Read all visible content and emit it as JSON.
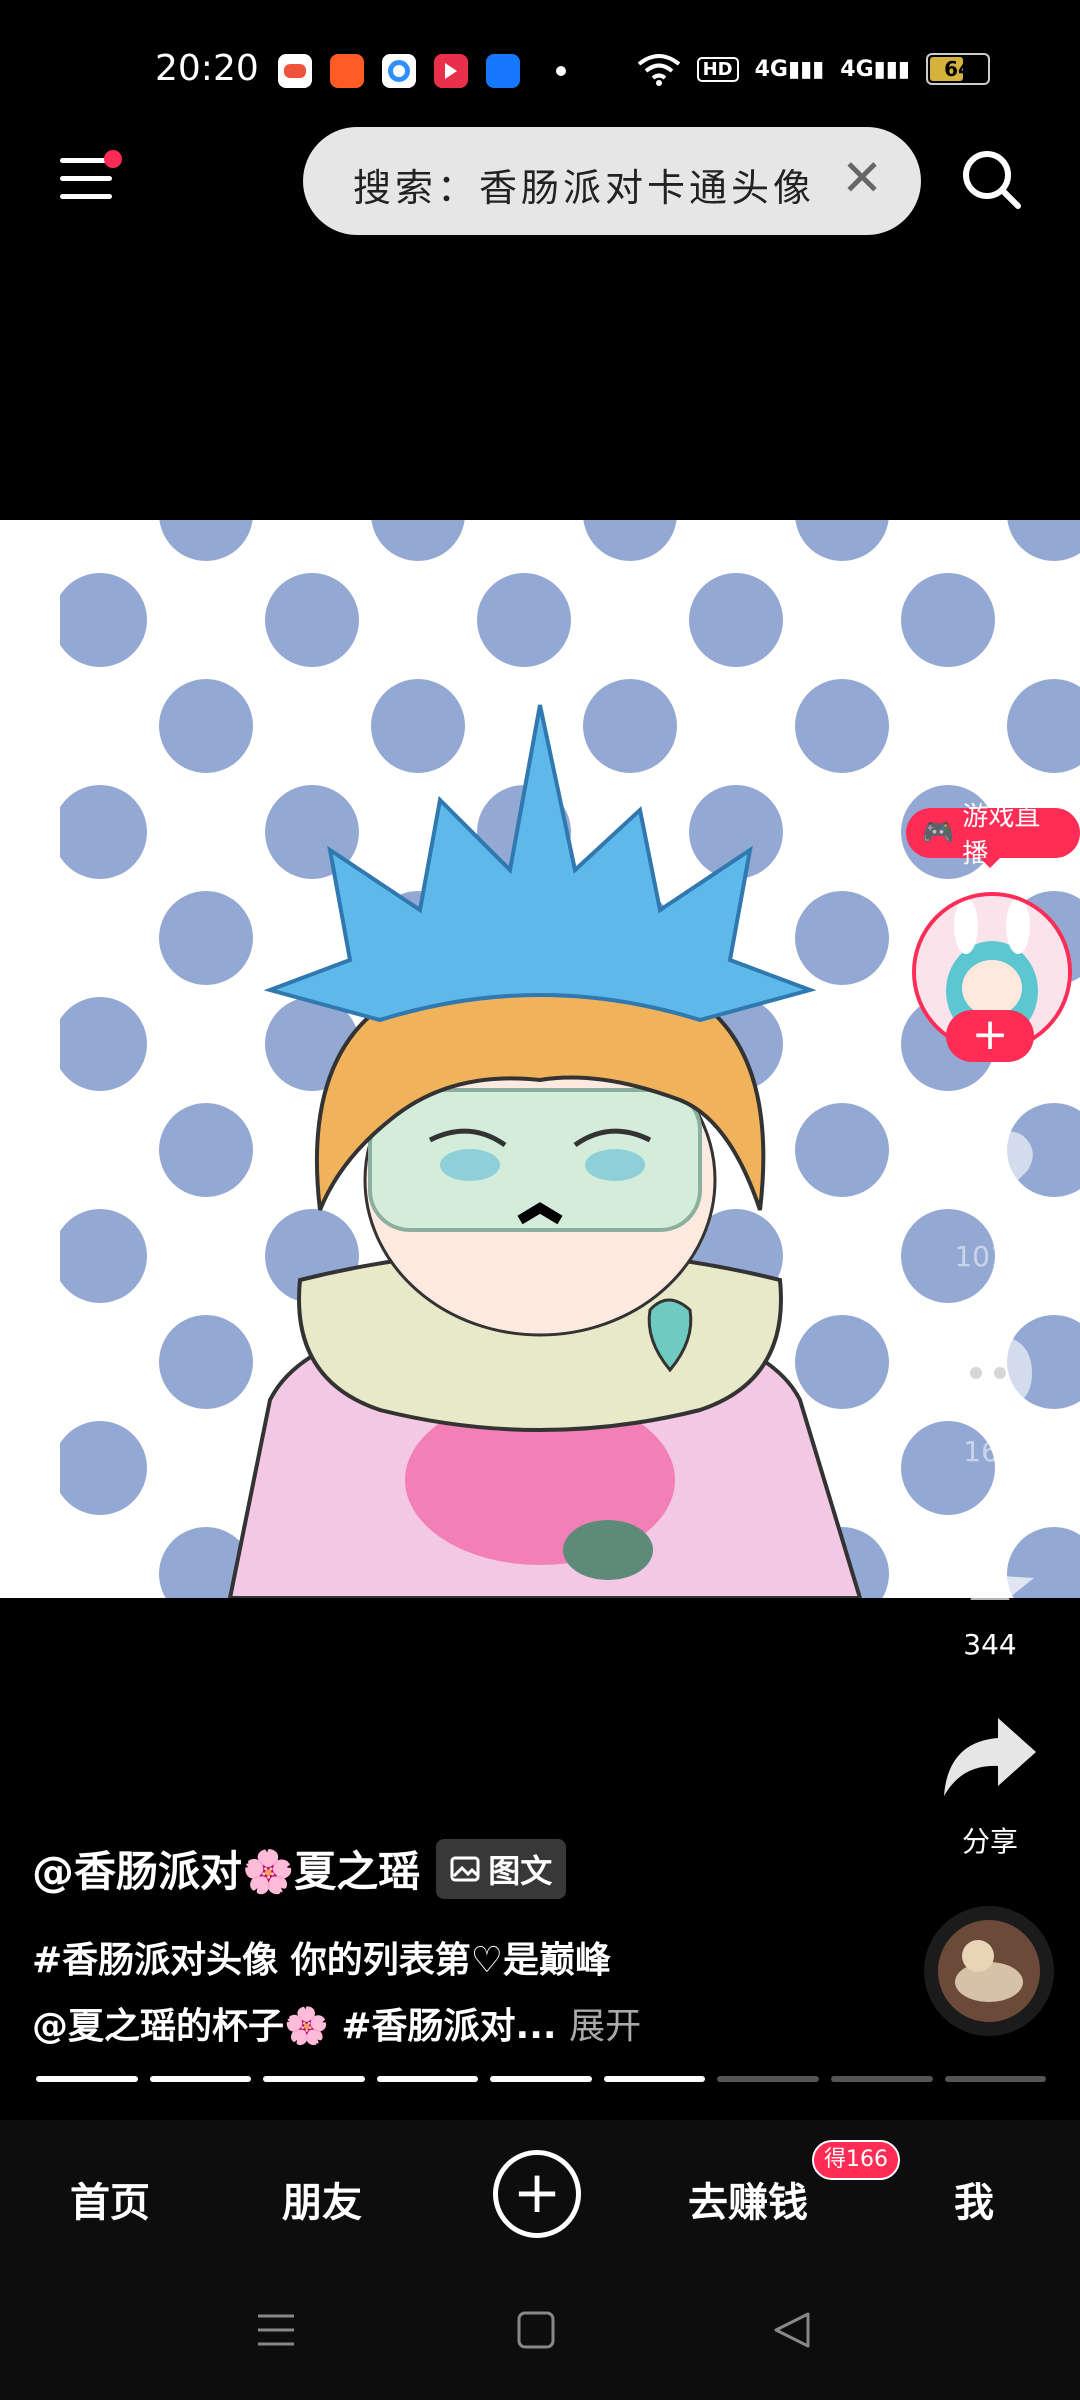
{
  "status_bar": {
    "time": "20:20",
    "hd_label": "HD",
    "network_1": "4G",
    "network_2": "4G",
    "battery": "64",
    "battery_level": 64
  },
  "header": {
    "search_text": "搜索：香肠派对卡通头像",
    "menu_has_notification": true
  },
  "right_rail": {
    "live_badge": "游戏直播",
    "follow_symbol": "+",
    "like_count": "1012",
    "comment_count": "160",
    "favorite_count": "344",
    "share_label": "分享"
  },
  "caption": {
    "author": "@香肠派对🌸夏之瑶",
    "post_type": "图文",
    "line1": "#香肠派对头像 你的列表第♡是巅峰",
    "line2": "@夏之瑶的杯子🌸 #香肠派对...",
    "expand": "展开",
    "progress_total": 9,
    "progress_current": 6
  },
  "bottom_nav": {
    "home": "首页",
    "friends": "朋友",
    "create": "+",
    "earn": "去赚钱",
    "earn_badge": "得166",
    "me": "我"
  },
  "colors": {
    "accent": "#ff2d55",
    "dot_blue": "#93a9d3",
    "background": "#000000"
  }
}
